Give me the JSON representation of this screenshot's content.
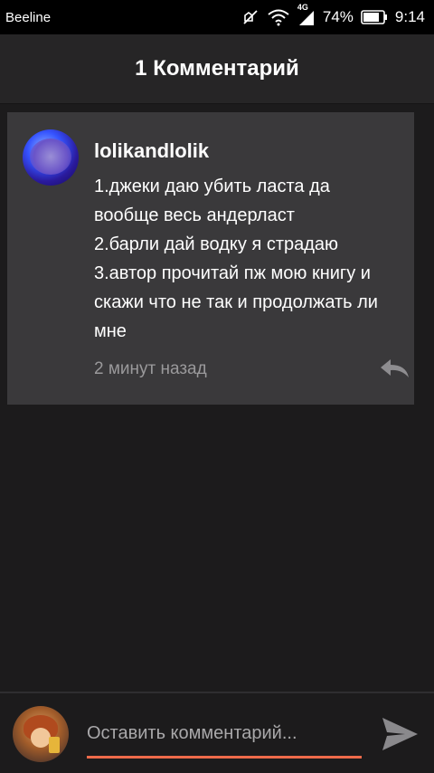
{
  "status_bar": {
    "carrier": "Beeline",
    "network": "4G",
    "battery_percent": "74%",
    "time": "9:14",
    "icons": [
      "mute-icon",
      "wifi-icon",
      "signal-icon",
      "battery-icon"
    ]
  },
  "header": {
    "title": "1 Комментарий"
  },
  "comments": [
    {
      "username": "lolikandlolik",
      "text_lines": [
        "1.джеки даю убить ласта да",
        "вообще весь андерласт",
        "2.барли дай водку я страдаю",
        "3.автор прочитай пж мою книгу и",
        "скажи что не так и продолжать ли",
        "мне"
      ],
      "time_ago": "2 минут назад",
      "reply_icon": "reply-icon"
    }
  ],
  "compose": {
    "placeholder": "Оставить комментарий...",
    "value": "",
    "send_icon": "send-icon",
    "underline_color": "#ee6a4a"
  }
}
